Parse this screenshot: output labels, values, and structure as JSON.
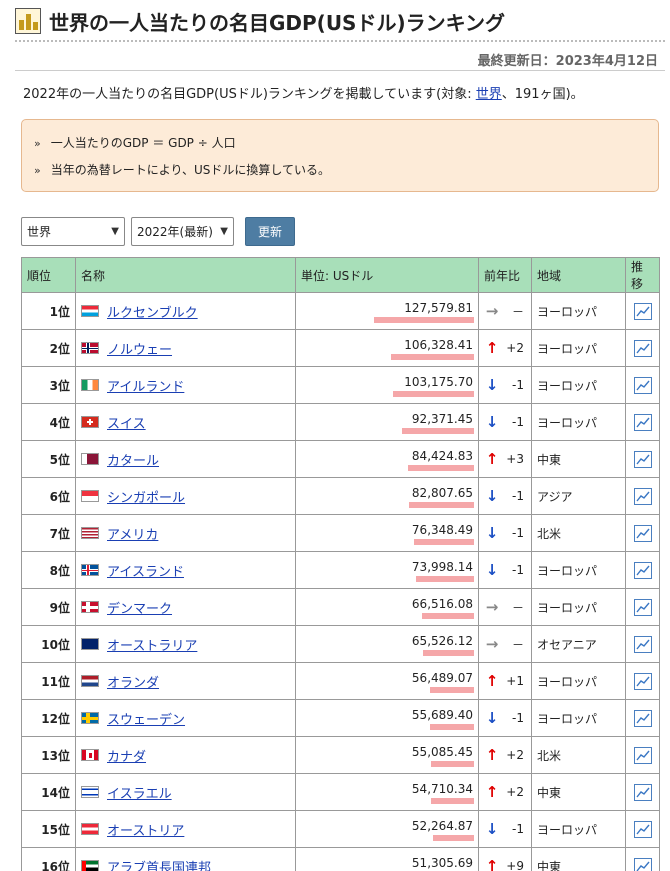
{
  "page": {
    "title": "世界の一人当たりの名目GDP(USドル)ランキング",
    "updated": "最終更新日：2023年4月12日",
    "intro_before": "2022年の一人当たりの名目GDP(USドル)ランキングを掲載しています(対象: ",
    "intro_link": "世界",
    "intro_after": "、191ヶ国)。"
  },
  "notes": [
    "一人当たりのGDP ＝ GDP ÷ 人口",
    "当年の為替レートにより、USドルに換算している。"
  ],
  "controls": {
    "region": "世界",
    "year": "2022年(最新)",
    "update_button": "更新"
  },
  "table": {
    "headers": [
      "順位",
      "名称",
      "単位: USドル",
      "前年比",
      "地域",
      "推移"
    ],
    "rows": [
      {
        "rank": "1位",
        "name": "ルクセンブルク",
        "value": "127,579.81",
        "bar": 1.0,
        "dir": "same",
        "change": "－",
        "region": "ヨーロッパ",
        "flag": "lu"
      },
      {
        "rank": "2位",
        "name": "ノルウェー",
        "value": "106,328.41",
        "bar": 0.833,
        "dir": "up",
        "change": "+2",
        "region": "ヨーロッパ",
        "flag": "no"
      },
      {
        "rank": "3位",
        "name": "アイルランド",
        "value": "103,175.70",
        "bar": 0.809,
        "dir": "down",
        "change": "-1",
        "region": "ヨーロッパ",
        "flag": "ie"
      },
      {
        "rank": "4位",
        "name": "スイス",
        "value": "92,371.45",
        "bar": 0.724,
        "dir": "down",
        "change": "-1",
        "region": "ヨーロッパ",
        "flag": "ch"
      },
      {
        "rank": "5位",
        "name": "カタール",
        "value": "84,424.83",
        "bar": 0.662,
        "dir": "up",
        "change": "+3",
        "region": "中東",
        "flag": "qa"
      },
      {
        "rank": "6位",
        "name": "シンガポール",
        "value": "82,807.65",
        "bar": 0.649,
        "dir": "down",
        "change": "-1",
        "region": "アジア",
        "flag": "sg"
      },
      {
        "rank": "7位",
        "name": "アメリカ",
        "value": "76,348.49",
        "bar": 0.598,
        "dir": "down",
        "change": "-1",
        "region": "北米",
        "flag": "us"
      },
      {
        "rank": "8位",
        "name": "アイスランド",
        "value": "73,998.14",
        "bar": 0.58,
        "dir": "down",
        "change": "-1",
        "region": "ヨーロッパ",
        "flag": "is"
      },
      {
        "rank": "9位",
        "name": "デンマーク",
        "value": "66,516.08",
        "bar": 0.521,
        "dir": "same",
        "change": "－",
        "region": "ヨーロッパ",
        "flag": "dk"
      },
      {
        "rank": "10位",
        "name": "オーストラリア",
        "value": "65,526.12",
        "bar": 0.514,
        "dir": "same",
        "change": "－",
        "region": "オセアニア",
        "flag": "au"
      },
      {
        "rank": "11位",
        "name": "オランダ",
        "value": "56,489.07",
        "bar": 0.443,
        "dir": "up",
        "change": "+1",
        "region": "ヨーロッパ",
        "flag": "nl"
      },
      {
        "rank": "12位",
        "name": "スウェーデン",
        "value": "55,689.40",
        "bar": 0.437,
        "dir": "down",
        "change": "-1",
        "region": "ヨーロッパ",
        "flag": "se"
      },
      {
        "rank": "13位",
        "name": "カナダ",
        "value": "55,085.45",
        "bar": 0.432,
        "dir": "up",
        "change": "+2",
        "region": "北米",
        "flag": "ca"
      },
      {
        "rank": "14位",
        "name": "イスラエル",
        "value": "54,710.34",
        "bar": 0.429,
        "dir": "up",
        "change": "+2",
        "region": "中東",
        "flag": "il"
      },
      {
        "rank": "15位",
        "name": "オーストリア",
        "value": "52,264.87",
        "bar": 0.41,
        "dir": "down",
        "change": "-1",
        "region": "ヨーロッパ",
        "flag": "at"
      },
      {
        "rank": "16位",
        "name": "アラブ首長国連邦",
        "value": "51,305.69",
        "bar": 0.402,
        "dir": "up",
        "change": "+9",
        "region": "中東",
        "flag": "ae"
      }
    ]
  },
  "colors": {
    "header_bg": "#a8dfb9",
    "bar": "#f5a7a9",
    "notes_bg": "#fdebd8",
    "button": "#4e7da3",
    "link": "#1a3fb3",
    "up_arrow": "#e00000",
    "down_arrow": "#1b4fc4"
  },
  "icons": {
    "title": "trophy-icon",
    "trend": "line-chart-icon",
    "up": "arrow-up-icon",
    "down": "arrow-down-icon",
    "same": "arrow-right-icon"
  }
}
